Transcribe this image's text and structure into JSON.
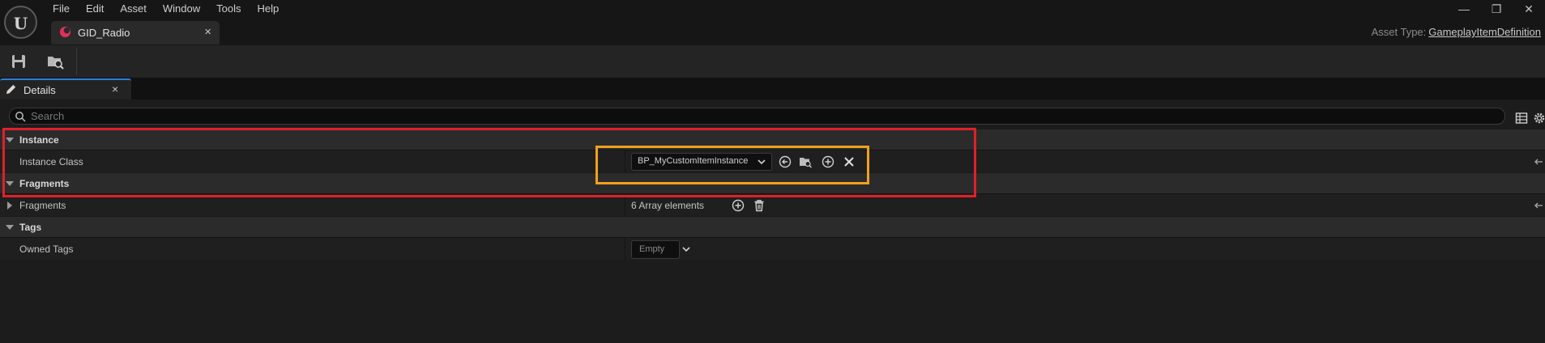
{
  "menubar": [
    "File",
    "Edit",
    "Asset",
    "Window",
    "Tools",
    "Help"
  ],
  "window": {
    "minimize": "—",
    "restore": "❐",
    "close": "✕"
  },
  "doc_tab": {
    "label": "GID_Radio",
    "close": "×"
  },
  "asset_type": {
    "prefix": "Asset Type:",
    "value": "GameplayItemDefinition"
  },
  "toolbar": {
    "icons": [
      "save-icon",
      "browse-to-asset-icon"
    ]
  },
  "details_tab": {
    "label": "Details",
    "close": "×",
    "icon": "pencil-icon"
  },
  "search": {
    "placeholder": "Search"
  },
  "categories": {
    "instance": "Instance",
    "fragments": "Fragments",
    "tags": "Tags"
  },
  "properties": {
    "instance_class": {
      "label": "Instance Class",
      "value": "BP_MyCustomItemInstance"
    },
    "fragments": {
      "label": "Fragments",
      "value": "6 Array elements"
    },
    "owned_tags": {
      "label": "Owned Tags",
      "value": "Empty"
    }
  },
  "colors": {
    "highlight_red": "#e0202a",
    "highlight_orange": "#f0a020",
    "accent_blue": "#2a7ed8",
    "tab_icon": "#e0305a"
  }
}
